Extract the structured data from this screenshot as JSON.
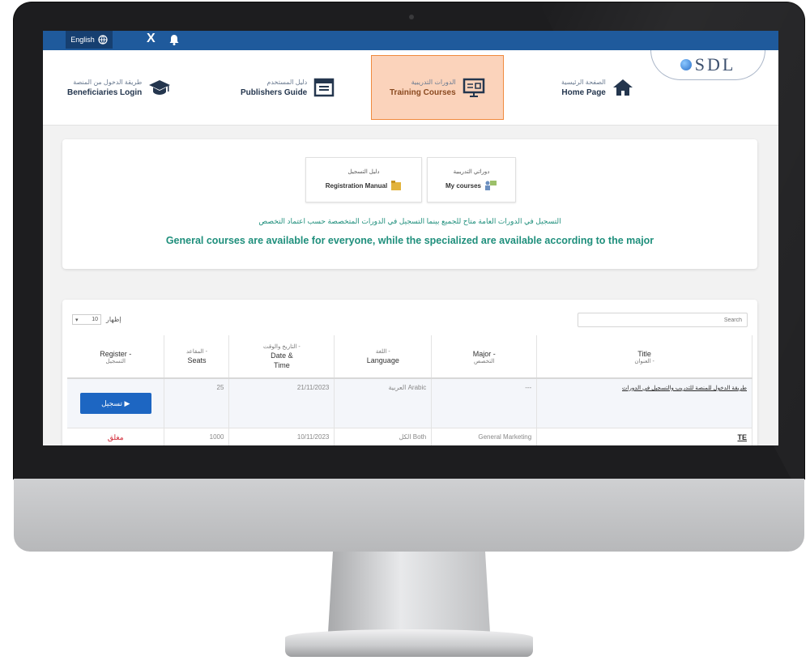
{
  "topbar": {
    "lang_label": "English",
    "social_x": "X"
  },
  "nav": {
    "home": {
      "ar": "الصفحة الرئيسية",
      "en": "Home Page"
    },
    "training": {
      "ar": "الدورات التدريبية",
      "en": "Training Courses"
    },
    "publishers": {
      "ar": "دليل المستخدم",
      "en": "Publishers Guide"
    },
    "beneficiaries": {
      "ar": "طريقة الدخول من المنصة",
      "en": "Beneficiaries Login"
    }
  },
  "logo": {
    "text": "SDL"
  },
  "cards": {
    "my_courses": {
      "ar": "دوراتي التدريبية",
      "en": "My courses"
    },
    "reg_manual": {
      "ar": "دليل التسجيل",
      "en": "Registration Manual"
    }
  },
  "notice": {
    "ar": "التسجيل في الدورات العامة متاح للجميع بينما التسجيل في الدورات المتخصصة حسب اعتماد التخصص",
    "en": "General courses are available for everyone, while the specialized are available according to the major"
  },
  "table_controls": {
    "show_label": "إظهار",
    "show_value": "10",
    "search_placeholder": "Search"
  },
  "table": {
    "headers": {
      "title": {
        "ar": "العنوان -",
        "en": "Title"
      },
      "major": {
        "ar": "التخصص",
        "en": "Major -"
      },
      "language": {
        "ar": "اللغة -",
        "en": "Language"
      },
      "datetime": {
        "ar": "التاريخ والوقت -",
        "en": "Date &",
        "en2": "Time"
      },
      "seats": {
        "ar": "المقاعد -",
        "en": "Seats"
      },
      "register": {
        "ar": "التسجيل",
        "en": "Register -"
      }
    },
    "rows": [
      {
        "title": "طريقة الدخول للمنصة للتدريب والتسجيل في الدورات",
        "major": "---",
        "language": "العربية Arabic",
        "datetime": "21/11/2023",
        "seats": "25",
        "register_label": "تسجيل"
      },
      {
        "title": "TE",
        "major": "General Marketing",
        "language": "الكل Both",
        "datetime": "10/11/2023",
        "seats": "1000",
        "register_label": "مغلق"
      }
    ]
  },
  "colors": {
    "topbar": "#1f5a9c",
    "accent_orange": "#f08a3e",
    "notice_green": "#1f8f7c",
    "register_blue": "#1d66c2"
  }
}
